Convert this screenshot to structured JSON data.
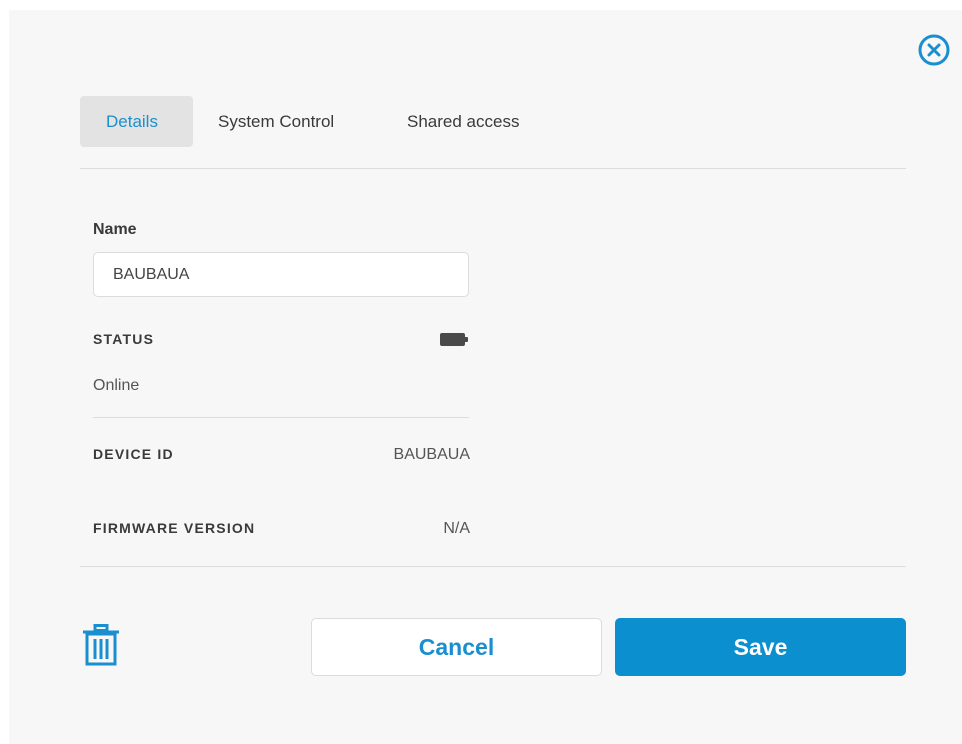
{
  "tabs": [
    {
      "label": "Details",
      "active": true
    },
    {
      "label": "System Control",
      "active": false
    },
    {
      "label": "Shared access",
      "active": false
    }
  ],
  "details": {
    "name_label": "Name",
    "name_value": "BAUBAUA",
    "status_label": "STATUS",
    "status_value": "Online",
    "battery_icon": "battery-icon",
    "device_id_label": "DEVICE ID",
    "device_id_value": "BAUBAUA",
    "firmware_label": "FIRMWARE VERSION",
    "firmware_value": "N/A"
  },
  "actions": {
    "cancel_label": "Cancel",
    "save_label": "Save",
    "delete_icon": "trash-icon",
    "close_icon": "close-circle-icon"
  },
  "colors": {
    "accent": "#0b8fcf",
    "panel_bg": "#f7f7f7",
    "active_tab_bg": "#e3e3e3"
  }
}
